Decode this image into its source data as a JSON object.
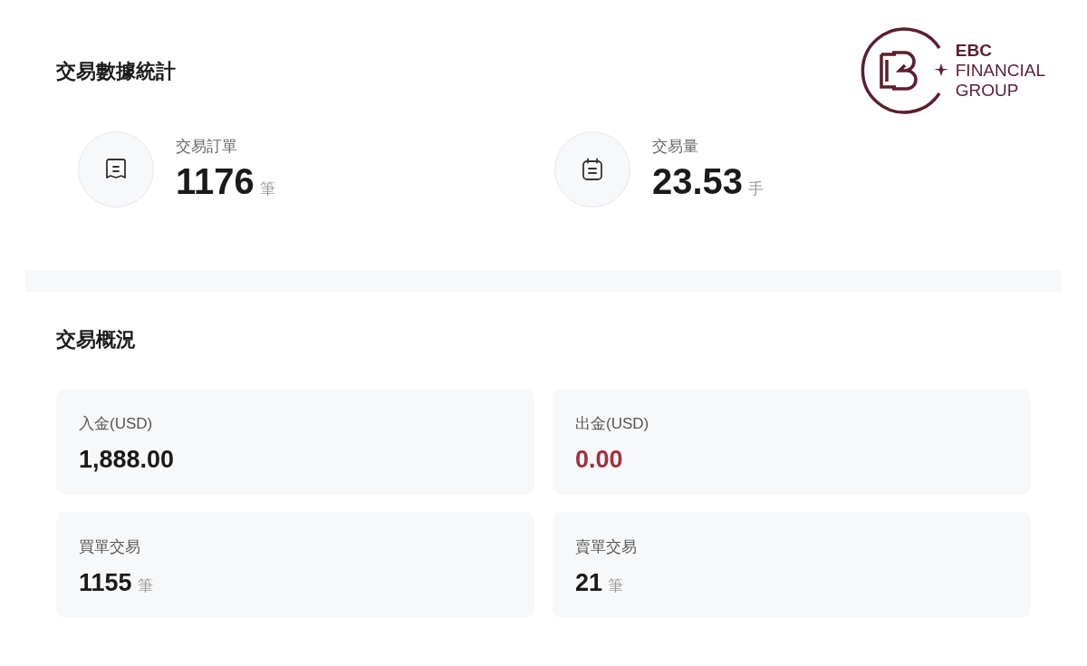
{
  "stats": {
    "title": "交易數據統計",
    "items": [
      {
        "kind": "orders",
        "label": "交易訂單",
        "value": "1176",
        "unit": "筆"
      },
      {
        "kind": "volume",
        "label": "交易量",
        "value": "23.53",
        "unit": "手"
      }
    ]
  },
  "logo": {
    "lines": [
      "EBC",
      "FINANCIAL",
      "GROUP"
    ]
  },
  "overview": {
    "title": "交易概況",
    "cards": [
      {
        "label": "入金(USD)",
        "value": "1,888.00",
        "color": "#1a1a1a"
      },
      {
        "label": "出金(USD)",
        "value": "0.00",
        "color": "#a3303d"
      },
      {
        "label": "買單交易",
        "value": "1155",
        "unit": "筆",
        "color": "#1a1a1a"
      },
      {
        "label": "賣單交易",
        "value": "21",
        "unit": "筆",
        "color": "#1a1a1a"
      }
    ]
  }
}
